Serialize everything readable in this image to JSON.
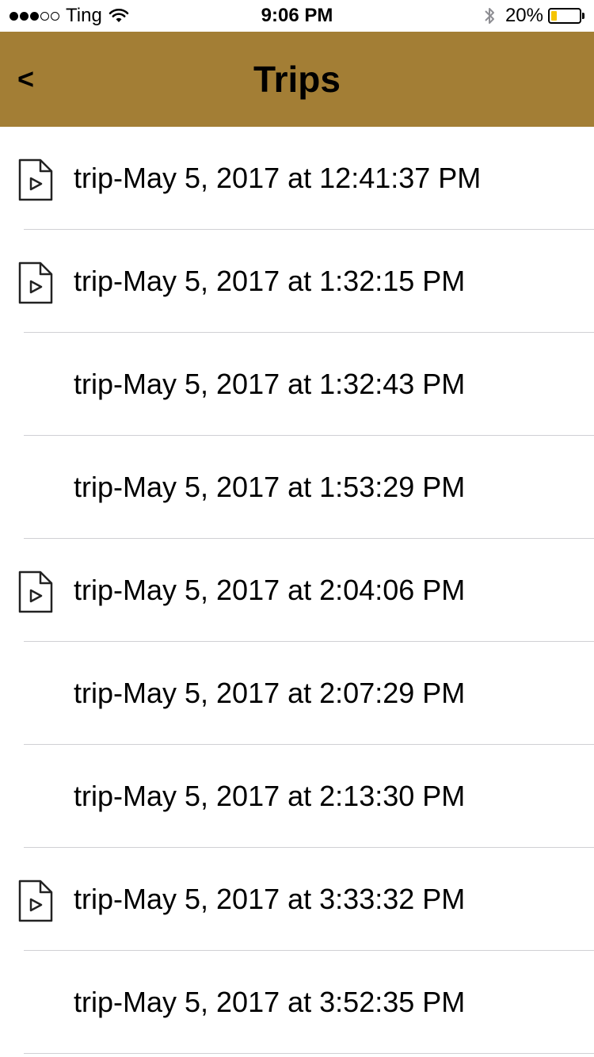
{
  "status_bar": {
    "carrier": "Ting",
    "signal_dots_filled": 3,
    "signal_dots_total": 5,
    "time": "9:06 PM",
    "battery_percent_text": "20%",
    "battery_level": 0.2,
    "battery_color": "#f5c400",
    "icons": [
      "wifi-icon",
      "bluetooth-icon",
      "battery-icon"
    ]
  },
  "nav": {
    "back_label": "<",
    "title": "Trips",
    "background_color": "#a37e35"
  },
  "trips": [
    {
      "label": "trip-May 5, 2017 at 12:41:37 PM",
      "has_video": true
    },
    {
      "label": "trip-May 5, 2017 at 1:32:15 PM",
      "has_video": true
    },
    {
      "label": "trip-May 5, 2017 at 1:32:43 PM",
      "has_video": false
    },
    {
      "label": "trip-May 5, 2017 at 1:53:29 PM",
      "has_video": false
    },
    {
      "label": "trip-May 5, 2017 at 2:04:06 PM",
      "has_video": true
    },
    {
      "label": "trip-May 5, 2017 at 2:07:29 PM",
      "has_video": false
    },
    {
      "label": "trip-May 5, 2017 at 2:13:30 PM",
      "has_video": false
    },
    {
      "label": "trip-May 5, 2017 at 3:33:32 PM",
      "has_video": true
    },
    {
      "label": "trip-May 5, 2017 at 3:52:35 PM",
      "has_video": false
    }
  ]
}
